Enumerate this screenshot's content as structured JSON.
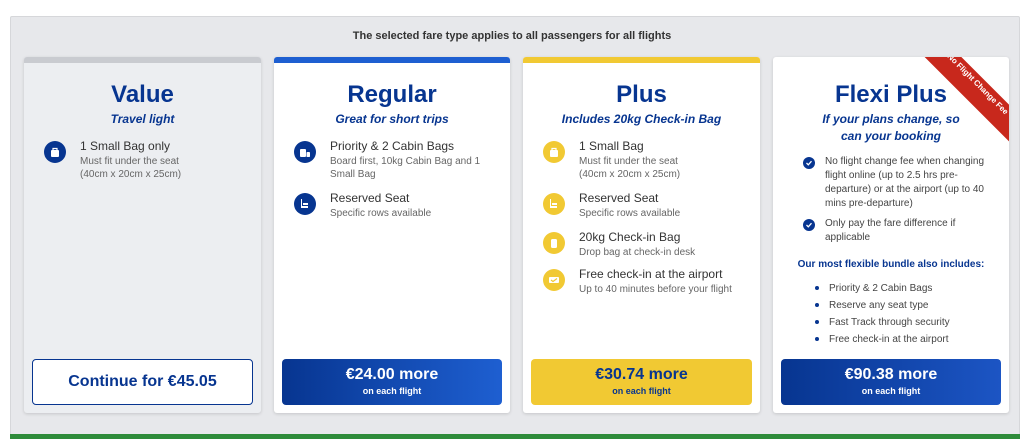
{
  "notice": "The selected fare type applies to all passengers for all flights",
  "colors": {
    "brand_blue": "#073590",
    "yellow": "#f1c933",
    "ribbon_red": "#c8281c",
    "topbar_value": "#c9cbd0",
    "topbar_regular": "#1e5fd1",
    "topbar_plus": "#f1c933"
  },
  "value": {
    "title": "Value",
    "tagline": "Travel light",
    "features": [
      {
        "icon": "small-bag-icon",
        "title": "1 Small Bag only",
        "sub": "Must fit under the seat (40cm x 20cm x 25cm)"
      }
    ],
    "button": "Continue for €45.05"
  },
  "regular": {
    "title": "Regular",
    "tagline": "Great for short trips",
    "features": [
      {
        "icon": "cabin-bags-icon",
        "title": "Priority & 2 Cabin Bags",
        "sub": "Board first, 10kg Cabin Bag and 1 Small Bag"
      },
      {
        "icon": "seat-icon",
        "title": "Reserved Seat",
        "sub": "Specific rows available"
      }
    ],
    "button_price": "€24.00 more",
    "button_sub": "on each flight"
  },
  "plus": {
    "title": "Plus",
    "tagline": "Includes 20kg Check-in Bag",
    "features": [
      {
        "icon": "small-bag-icon",
        "title": "1 Small Bag",
        "sub": "Must fit under the seat (40cm x 20cm x 25cm)"
      },
      {
        "icon": "seat-icon",
        "title": "Reserved Seat",
        "sub": "Specific rows available"
      },
      {
        "icon": "checkin-bag-icon",
        "title": "20kg Check-in Bag",
        "sub": "Drop bag at check-in desk"
      },
      {
        "icon": "boarding-pass-icon",
        "title": "Free check-in at the airport",
        "sub": "Up to 40 minutes before your flight"
      }
    ],
    "button_price": "€30.74 more",
    "button_sub": "on each flight"
  },
  "flexi": {
    "title": "Flexi Plus",
    "tagline": "If your plans change, so can your booking",
    "ribbon": "No Flight Change Fee",
    "checks": [
      "No flight change fee when changing flight online (up to 2.5 hrs pre-departure) or at the airport (up to 40 mins pre-departure)",
      "Only pay the fare difference if applicable"
    ],
    "bundle_heading": "Our most flexible bundle also includes:",
    "bundle": [
      "Priority & 2 Cabin Bags",
      "Reserve any seat type",
      "Fast Track through security",
      "Free check-in at the airport"
    ],
    "button_price": "€90.38 more",
    "button_sub": "on each flight"
  }
}
